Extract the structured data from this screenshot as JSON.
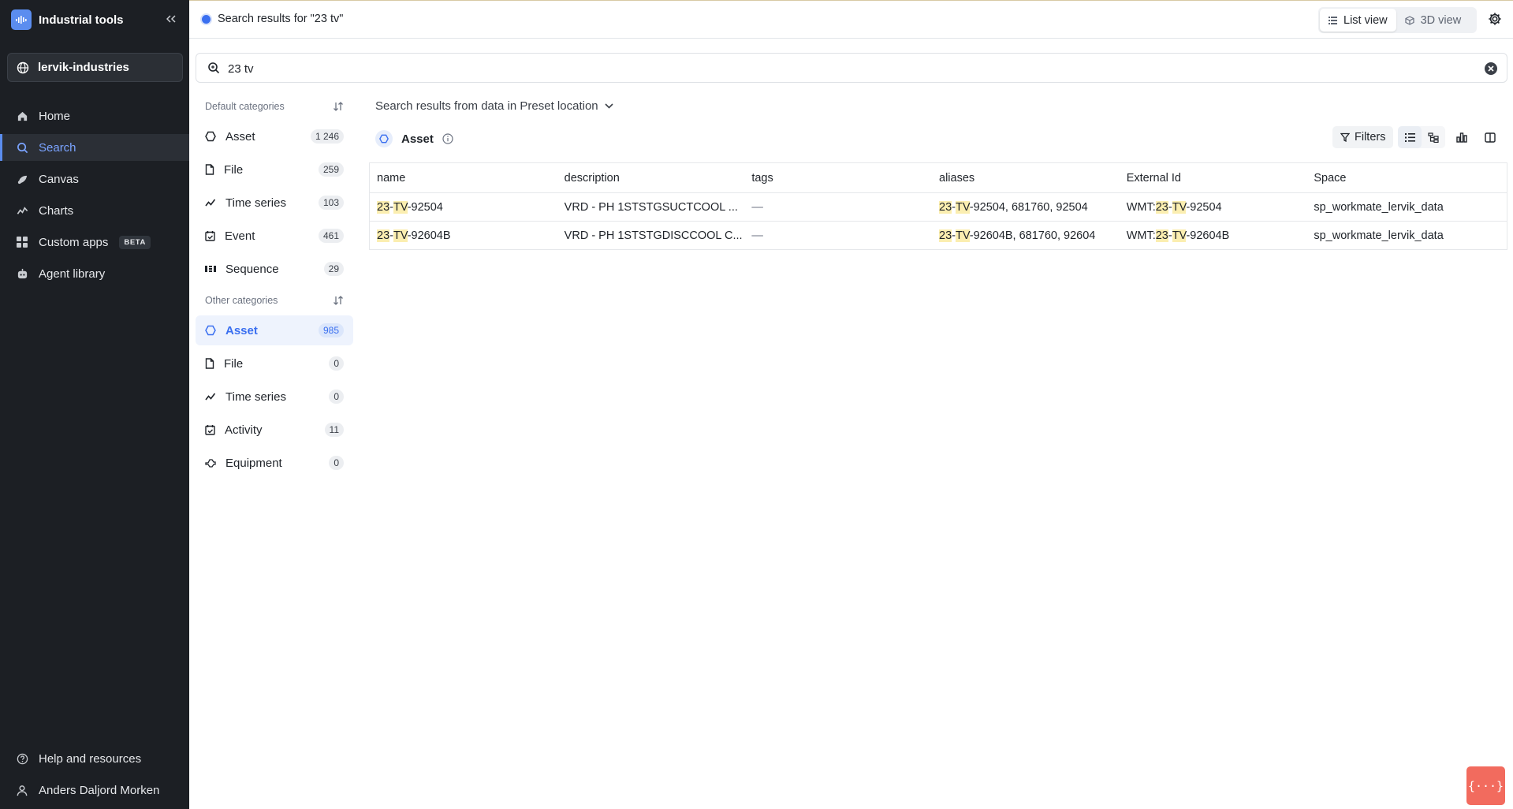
{
  "sidebar": {
    "app_title": "Industrial tools",
    "project": "lervik-industries",
    "nav": [
      {
        "label": "Home",
        "icon": "home-icon"
      },
      {
        "label": "Search",
        "icon": "search-icon",
        "active": true
      },
      {
        "label": "Canvas",
        "icon": "canvas-icon"
      },
      {
        "label": "Charts",
        "icon": "charts-icon"
      },
      {
        "label": "Custom apps",
        "icon": "apps-grid-icon",
        "badge": "BETA"
      },
      {
        "label": "Agent library",
        "icon": "robot-icon"
      }
    ],
    "help_label": "Help and resources",
    "user_name": "Anders Daljord Morken"
  },
  "topbar": {
    "breadcrumb": "Search results for \"23 tv\"",
    "list_view_label": "List view",
    "view3d_label": "3D view"
  },
  "search": {
    "value": "23 tv"
  },
  "categories": {
    "default_header": "Default categories",
    "default_items": [
      {
        "label": "Asset",
        "count": "1 246",
        "icon": "asset-icon"
      },
      {
        "label": "File",
        "count": "259",
        "icon": "file-icon"
      },
      {
        "label": "Time series",
        "count": "103",
        "icon": "timeseries-icon"
      },
      {
        "label": "Event",
        "count": "461",
        "icon": "event-icon"
      },
      {
        "label": "Sequence",
        "count": "29",
        "icon": "sequence-icon"
      }
    ],
    "other_header": "Other categories",
    "other_items": [
      {
        "label": "Asset",
        "count": "985",
        "icon": "asset-icon",
        "active": true
      },
      {
        "label": "File",
        "count": "0",
        "icon": "file-icon"
      },
      {
        "label": "Time series",
        "count": "0",
        "icon": "timeseries-icon"
      },
      {
        "label": "Activity",
        "count": "11",
        "icon": "activity-icon"
      },
      {
        "label": "Equipment",
        "count": "0",
        "icon": "equipment-icon"
      }
    ]
  },
  "results": {
    "location_text": "Search results from data in Preset location",
    "type_title": "Asset",
    "filters_label": "Filters",
    "columns": [
      "name",
      "description",
      "tags",
      "aliases",
      "External Id",
      "Space"
    ],
    "rows": [
      {
        "name": [
          "23",
          "-",
          "TV",
          "-92504"
        ],
        "description": "VRD - PH 1STSTGSUCTCOOL ...",
        "tags": "—",
        "aliases": [
          "23",
          "-",
          "TV",
          "-92504, 681760, 92504"
        ],
        "external_id": [
          "WMT:",
          "23",
          "-",
          "TV",
          "-92504"
        ],
        "space": "sp_workmate_lervik_data"
      },
      {
        "name": [
          "23",
          "-",
          "TV",
          "-92604B"
        ],
        "description": "VRD - PH 1STSTGDISCCOOL C...",
        "tags": "—",
        "aliases": [
          "23",
          "-",
          "TV",
          "-92604B, 681760, 92604"
        ],
        "external_id": [
          "WMT:",
          "23",
          "-",
          "TV",
          "-92604B"
        ],
        "space": "sp_workmate_lervik_data"
      }
    ]
  },
  "fab_label": "{···}",
  "colors": {
    "accent": "#5b8def",
    "sidebar_bg": "#1c1f24",
    "highlight": "#fbeeb0",
    "fab": "#f26b5e"
  }
}
